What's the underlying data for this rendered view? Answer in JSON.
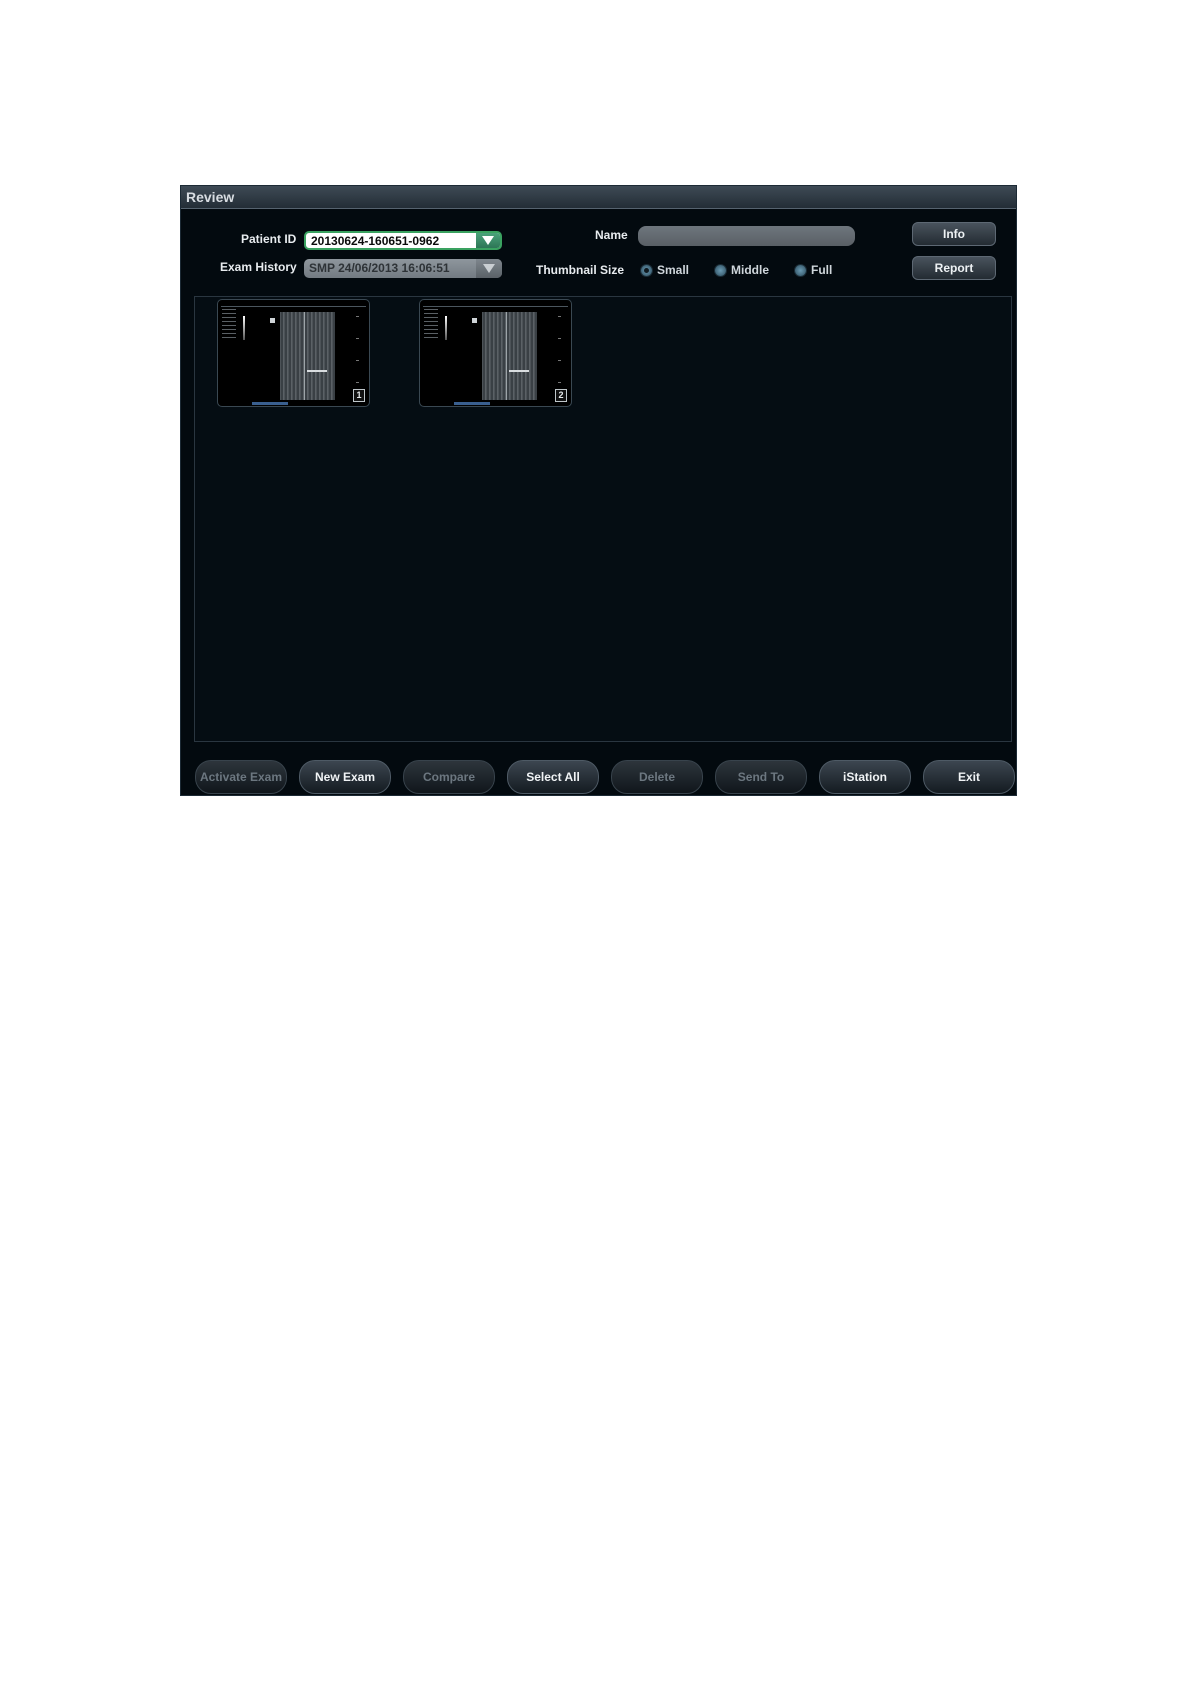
{
  "window": {
    "title": "Review"
  },
  "patient": {
    "label": "Patient ID",
    "value": "20130624-160651-0962"
  },
  "exam_history": {
    "label": "Exam History",
    "value": "SMP 24/06/2013 16:06:51"
  },
  "name": {
    "label": "Name",
    "value": ""
  },
  "thumbnail_size": {
    "label": "Thumbnail Size",
    "options": [
      {
        "label": "Small",
        "selected": true
      },
      {
        "label": "Middle",
        "selected": false
      },
      {
        "label": "Full",
        "selected": false
      }
    ]
  },
  "side_buttons": {
    "info": "Info",
    "report": "Report"
  },
  "thumbnails": [
    {
      "number": "1"
    },
    {
      "number": "2"
    }
  ],
  "bottom_buttons": [
    {
      "label": "Activate Exam",
      "enabled": false
    },
    {
      "label": "New Exam",
      "enabled": true
    },
    {
      "label": "Compare",
      "enabled": false
    },
    {
      "label": "Select All",
      "enabled": true
    },
    {
      "label": "Delete",
      "enabled": false
    },
    {
      "label": "Send To",
      "enabled": false
    },
    {
      "label": "iStation",
      "enabled": true
    },
    {
      "label": "Exit",
      "enabled": true
    }
  ]
}
